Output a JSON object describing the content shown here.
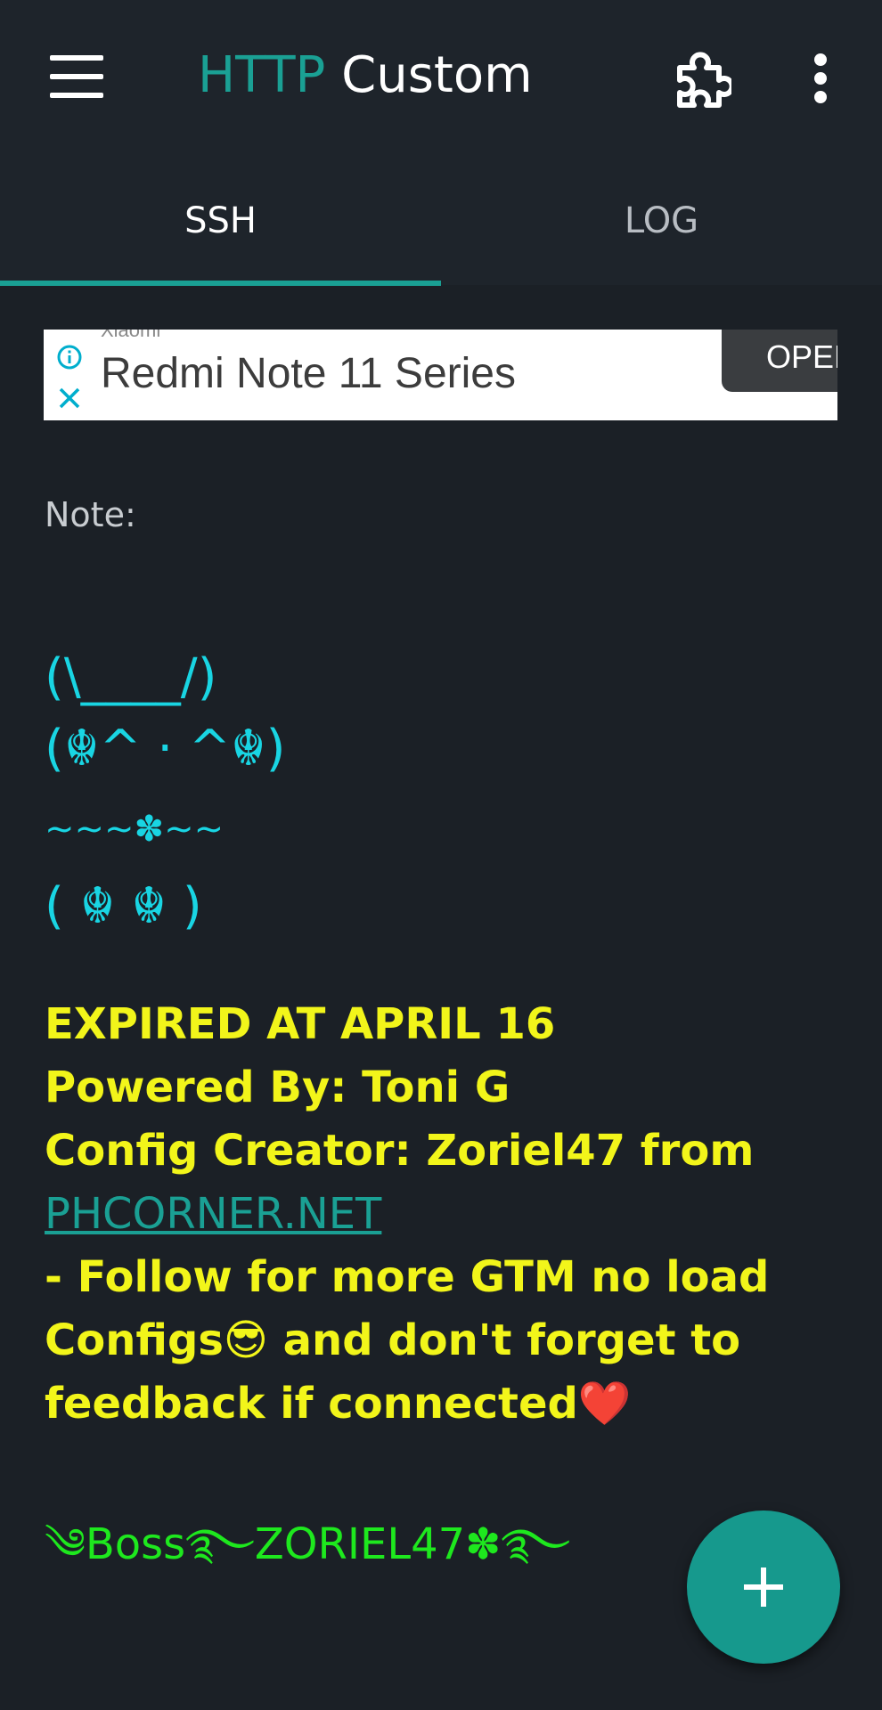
{
  "app_bar": {
    "title_part1": "HTTP",
    "title_part2": "Custom",
    "menu_icon": "hamburger-menu-icon",
    "extension_icon": "puzzle-piece-icon",
    "overflow_icon": "more-vert-icon"
  },
  "tabs": [
    {
      "label": "SSH",
      "selected": true
    },
    {
      "label": "LOG",
      "selected": false
    }
  ],
  "ad": {
    "brand": "Xiaomi",
    "headline": "Redmi Note 11 Series",
    "open_label": "OPEN",
    "info_icon": "info-icon",
    "close_icon": "close-icon"
  },
  "note": {
    "label": "Note:",
    "ascii_art": [
      "(\\____/)",
      "(☬^ · ^☬)",
      "~~~✽~~",
      "( ☬ ☬ )"
    ],
    "message_lines": [
      "EXPIRED AT APRIL 16",
      "Powered By: Toni G",
      "Config Creator: Zoriel47 from"
    ],
    "link_text": "PHCORNER.NET",
    "message_lines_after": [
      "- Follow for more GTM no load",
      "Configs😎 and don't forget to",
      "feedback if connected❤️"
    ],
    "signature": "༄Boss࿐ZORIEL47✽࿐"
  },
  "fab": {
    "icon": "plus-icon"
  },
  "colors": {
    "accent": "#1aa094",
    "background": "#1b2026",
    "ascii": "#19d5e3",
    "message": "#f2f51a",
    "signature": "#1ee81e"
  }
}
